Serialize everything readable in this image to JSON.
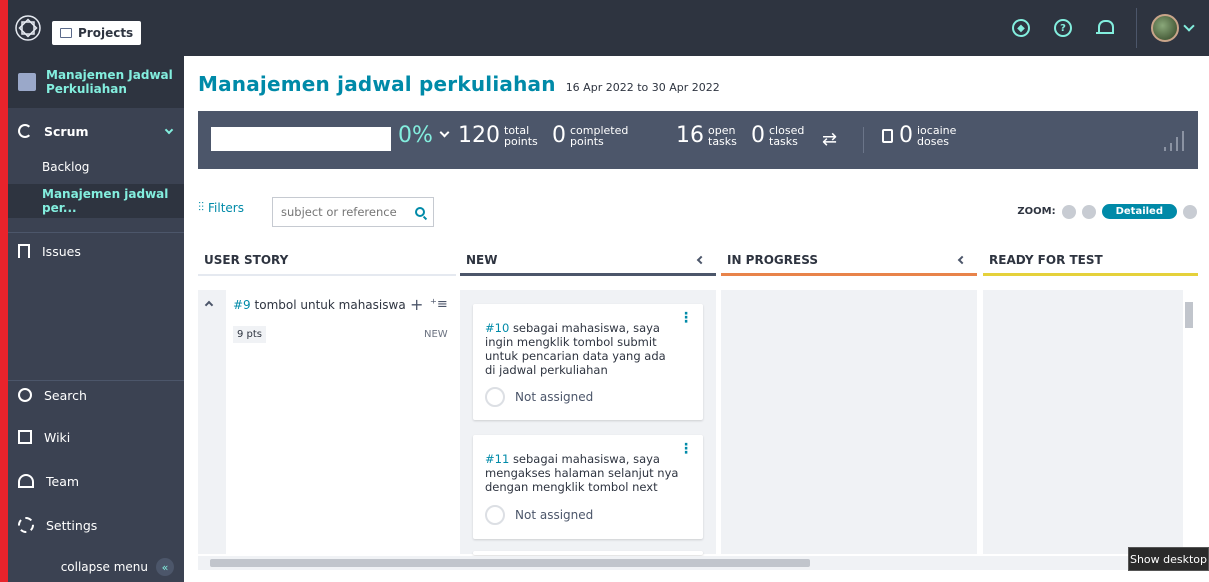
{
  "topbar": {
    "projects_label": "Projects"
  },
  "sidebar": {
    "project_name_line1": "Manajemen Jadwal",
    "project_name_line2": "Perkuliahan",
    "scrum_label": "Scrum",
    "backlog_label": "Backlog",
    "active_sprint_label": "Manajemen jadwal per...",
    "issues_label": "Issues",
    "search_label": "Search",
    "wiki_label": "Wiki",
    "team_label": "Team",
    "settings_label": "Settings",
    "collapse_label": "collapse menu"
  },
  "page": {
    "title": "Manajemen jadwal perkuliahan",
    "dates": "16 Apr 2022 to 30 Apr 2022"
  },
  "stats": {
    "percent": "0%",
    "total_points": "120",
    "total_points_l1": "total",
    "total_points_l2": "points",
    "completed_points": "0",
    "completed_l1": "completed",
    "completed_l2": "points",
    "open_tasks": "16",
    "open_l1": "open",
    "open_l2": "tasks",
    "closed_tasks": "0",
    "closed_l1": "closed",
    "closed_l2": "tasks",
    "iocaine": "0",
    "iocaine_l1": "iocaine",
    "iocaine_l2": "doses"
  },
  "filters": {
    "label": "Filters",
    "search_placeholder": "subject or reference"
  },
  "zoom": {
    "label": "ZOOM:",
    "active_level": "Detailed"
  },
  "columns": {
    "user_story": "USER STORY",
    "new": "NEW",
    "in_progress": "IN PROGRESS",
    "ready_for_test": "READY FOR TEST"
  },
  "colors": {
    "accent": "#008aa8",
    "new_border": "#4c566a",
    "in_progress_border": "#e8834a",
    "ready_border": "#e5d13b"
  },
  "user_story": {
    "ref": "#9",
    "title": "tombol untuk mahasiswa",
    "points": "9 pts",
    "status": "NEW"
  },
  "cards": [
    {
      "ref": "#10",
      "text": "sebagai mahasiswa, saya ingin mengklik tombol submit untuk pencarian data yang ada di jadwal perkuliahan",
      "assignee": "Not assigned"
    },
    {
      "ref": "#11",
      "text": "sebagai mahasiswa, saya mengakses halaman selanjut nya dengan mengklik tombol next",
      "assignee": "Not assigned"
    }
  ],
  "tooltip": "Show desktop"
}
